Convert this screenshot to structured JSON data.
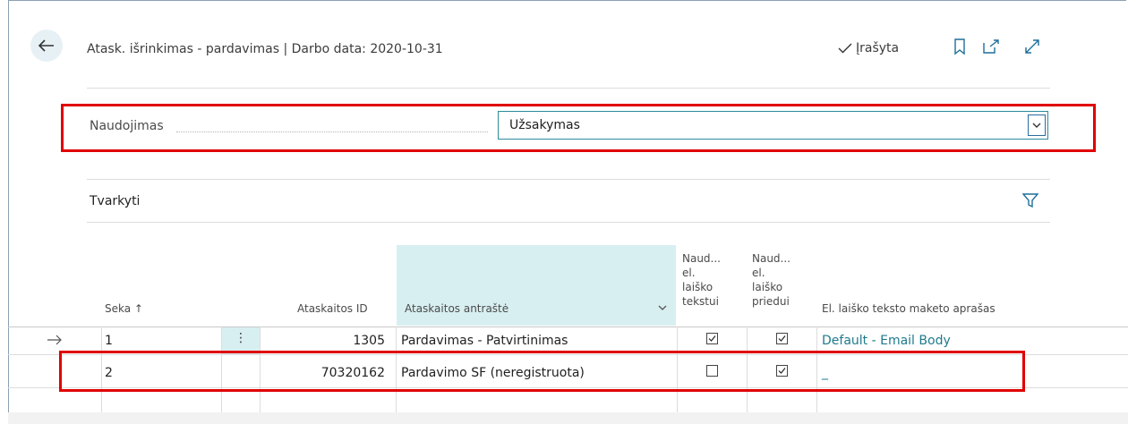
{
  "header": {
    "title": "Atask. išrinkimas - pardavimas | Darbo data: 2020-10-31",
    "status": "Įrašyta"
  },
  "usage": {
    "label": "Naudojimas",
    "value": "Užsakymas"
  },
  "section": {
    "label": "Tvarkyti"
  },
  "table": {
    "columns": {
      "seka": "Seka ↑",
      "report_id": "Ataskaitos ID",
      "report_caption": "Ataskaitos antraštė",
      "email_body": [
        "Naud...",
        "el.",
        "laiško",
        "tekstui"
      ],
      "email_attach": [
        "Naud...",
        "el.",
        "laiško",
        "priedui"
      ],
      "layout_desc": "El. laiško teksto maketo aprašas"
    },
    "rows": [
      {
        "seka": "1",
        "menu": "⋮",
        "report_id": "1305",
        "caption": "Pardavimas - Patvirtinimas",
        "email_body": true,
        "email_attach": true,
        "layout": "Default - Email Body"
      },
      {
        "seka": "2",
        "menu": "",
        "report_id": "70320162",
        "caption": "Pardavimo SF (neregistruota)",
        "email_body": false,
        "email_attach": true,
        "layout": "_"
      }
    ]
  },
  "colors": {
    "accent": "#2a8c9b",
    "highlight": "#e00000",
    "selected_col": "#d8eff1"
  },
  "icons": [
    "back-arrow-icon",
    "checkmark-icon",
    "bookmark-icon",
    "open-new-window-icon",
    "expand-icon",
    "chevron-down-icon",
    "filter-icon",
    "row-arrow-icon"
  ]
}
